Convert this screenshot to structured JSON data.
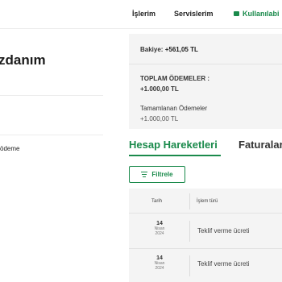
{
  "nav": {
    "items": [
      {
        "label": "İşlerim"
      },
      {
        "label": "Servislerim"
      },
      {
        "label": "Kullanılabi"
      }
    ]
  },
  "left": {
    "title": "zdanım",
    "menu_item": "ödeme"
  },
  "summary": {
    "balance_label": "Bakiye:",
    "balance_value": "+561,05 TL",
    "total_label": "TOPLAM ÖDEMELER :",
    "total_value": "+1.000,00 TL",
    "completed_label": "Tamamlanan Ödemeler",
    "completed_value": "+1.000,00 TL"
  },
  "tabs": [
    {
      "label": "Hesap Hareketleri",
      "active": true
    },
    {
      "label": "Faturalar",
      "active": false
    }
  ],
  "filter": {
    "label": "Filtrele"
  },
  "table": {
    "headers": [
      "Tarih",
      "İşlem türü"
    ],
    "rows": [
      {
        "day": "14",
        "month": "Nisan",
        "year": "2024",
        "type": "Teklif verme ücreti"
      },
      {
        "day": "14",
        "month": "Nisan",
        "year": "2024",
        "type": "Teklif verme ücreti"
      }
    ]
  },
  "colors": {
    "accent": "#1a8a4b",
    "panel": "#f4f4f4"
  }
}
